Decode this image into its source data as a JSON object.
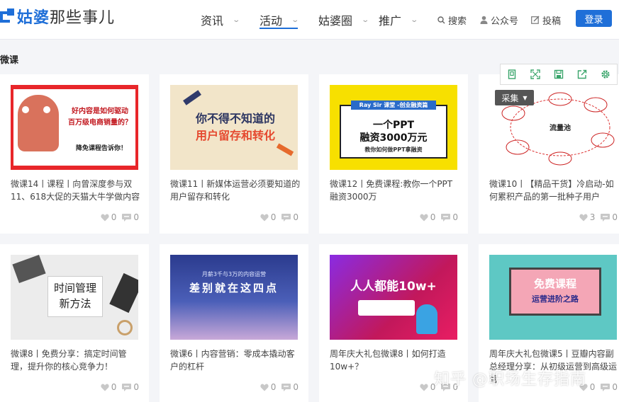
{
  "header": {
    "logo_main": "姑婆",
    "logo_sub": "那些事儿",
    "nav": [
      {
        "label": "资讯"
      },
      {
        "label": "活动"
      },
      {
        "label": "姑婆圈"
      },
      {
        "label": "推广"
      }
    ],
    "search_label": "搜索",
    "wechat_label": "公众号",
    "submit_label": "投稿",
    "login_label": "登录"
  },
  "section_title": "微课",
  "toolbar": {
    "collect_label": "采集"
  },
  "cards": [
    {
      "title": "微课14丨课程丨向曾深度参与双11、618大促的天猫大牛学做内容",
      "likes": "0",
      "comments": "0",
      "thumb_lines": [
        "好内容是如何驱动",
        "百万级电商销量的？",
        "降免课程告诉你！"
      ]
    },
    {
      "title": "微课11丨新媒体运营必须要知道的用户留存和转化",
      "likes": "0",
      "comments": "0",
      "thumb_lines": [
        "你不得不知道的",
        "用户留存和转化"
      ]
    },
    {
      "title": "微课12丨免费课程:教你一个PPT融资3000万",
      "likes": "0",
      "comments": "0",
      "thumb_lines": [
        "Ray Sir 课堂 -创业融资篇",
        "一个PPT",
        "融资3000万元",
        "教你如何做PPT拿融资"
      ]
    },
    {
      "title": "微课10丨【精品干货】冷启动-如何累积产品的第一批种子用户",
      "likes": "3",
      "comments": "0",
      "thumb_lines": [
        "流量池"
      ]
    },
    {
      "title": "微课8丨免费分享：搞定时间管理，提升你的核心竞争力！",
      "likes": "0",
      "comments": "0",
      "thumb_lines": [
        "时间管理",
        "新方法"
      ]
    },
    {
      "title": "微课6丨内容营销：零成本撬动客户的杠杆",
      "likes": "0",
      "comments": "0",
      "thumb_lines": [
        "月薪3千与3万的内容运营",
        "差别就在这四点"
      ]
    },
    {
      "title": "周年庆大礼包微课8丨如何打造10w+？",
      "likes": "0",
      "comments": "0",
      "thumb_lines": [
        "人人都能10w+"
      ]
    },
    {
      "title": "周年庆大礼包微课5丨豆瓣内容副总经理分享：从初级运营到高级运营",
      "likes": "0",
      "comments": "0",
      "thumb_lines": [
        "免费课程",
        "运营进阶之路"
      ]
    }
  ],
  "watermark": "知乎 @职场生存指南",
  "colors": {
    "accent": "#1f6fd8"
  }
}
